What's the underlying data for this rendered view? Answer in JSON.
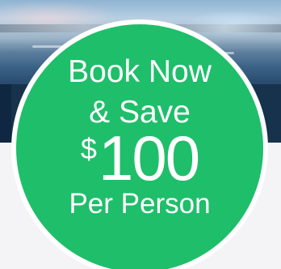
{
  "promo": {
    "line1": "Book Now",
    "line2": "& Save",
    "currency": "$",
    "amount": "100",
    "line4": "Per Person"
  },
  "colors": {
    "badge_green": "#1fbe6a",
    "ring": "#ffffff",
    "band_navy": "#17324d"
  }
}
